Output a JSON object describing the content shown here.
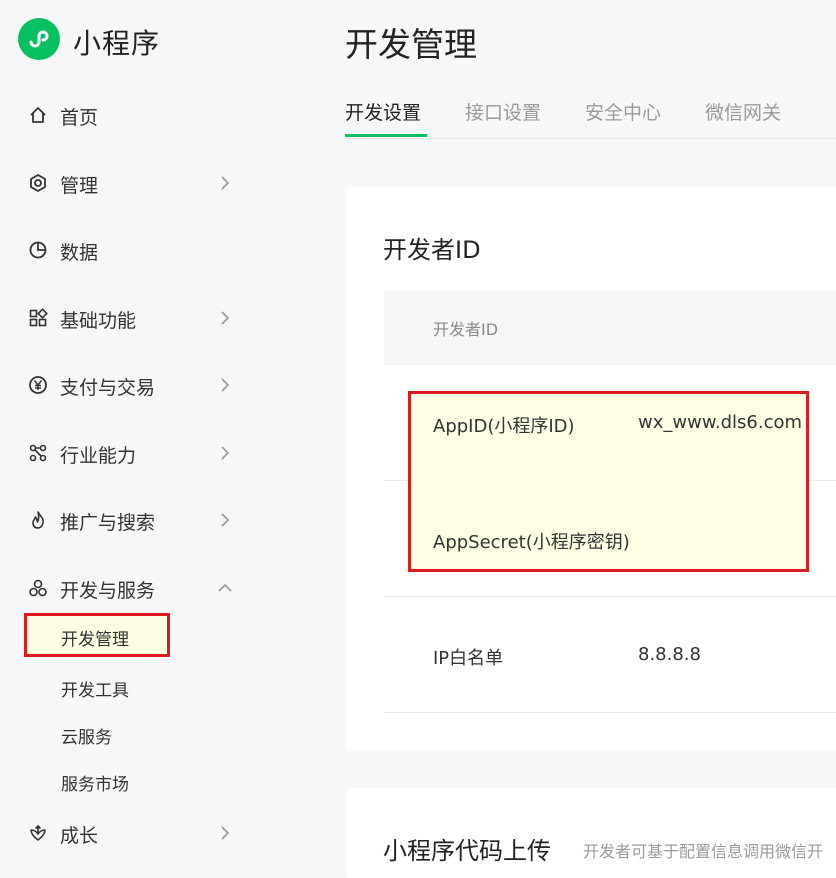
{
  "brand": {
    "name": "小程序",
    "logo_icon": "miniprogram-logo-icon",
    "logo_color": "#07c160"
  },
  "sidebar": {
    "items": [
      {
        "label": "首页",
        "icon": "home-icon"
      },
      {
        "label": "管理",
        "icon": "hexagon-icon"
      },
      {
        "label": "数据",
        "icon": "pie-chart-icon"
      },
      {
        "label": "基础功能",
        "icon": "grid-icon"
      },
      {
        "label": "支付与交易",
        "icon": "yen-icon"
      },
      {
        "label": "行业能力",
        "icon": "network-icon"
      },
      {
        "label": "推广与搜索",
        "icon": "flame-icon"
      },
      {
        "label": "开发与服务",
        "icon": "cubes-icon"
      },
      {
        "label": "成长",
        "icon": "growth-icon"
      }
    ],
    "sub_items": [
      {
        "label": "开发管理",
        "active": true
      },
      {
        "label": "开发工具"
      },
      {
        "label": "云服务"
      },
      {
        "label": "服务市场"
      }
    ]
  },
  "main": {
    "title": "开发管理",
    "tabs": [
      {
        "label": "开发设置",
        "active": true
      },
      {
        "label": "接口设置"
      },
      {
        "label": "安全中心"
      },
      {
        "label": "微信网关"
      }
    ],
    "developer_card": {
      "title": "开发者ID",
      "table_header": "开发者ID",
      "rows": [
        {
          "label": "AppID(小程序ID)",
          "value": "wx_www.dls6.com"
        },
        {
          "label": "AppSecret(小程序密钥)",
          "value": ""
        },
        {
          "label": "IP白名单",
          "value": "8.8.8.8"
        }
      ]
    },
    "upload_card": {
      "title": "小程序代码上传",
      "description": "开发者可基于配置信息调用微信开"
    }
  },
  "colors": {
    "accent": "#07c160",
    "highlight_border": "#dd1c22",
    "highlight_bg": "#fdfee3"
  }
}
